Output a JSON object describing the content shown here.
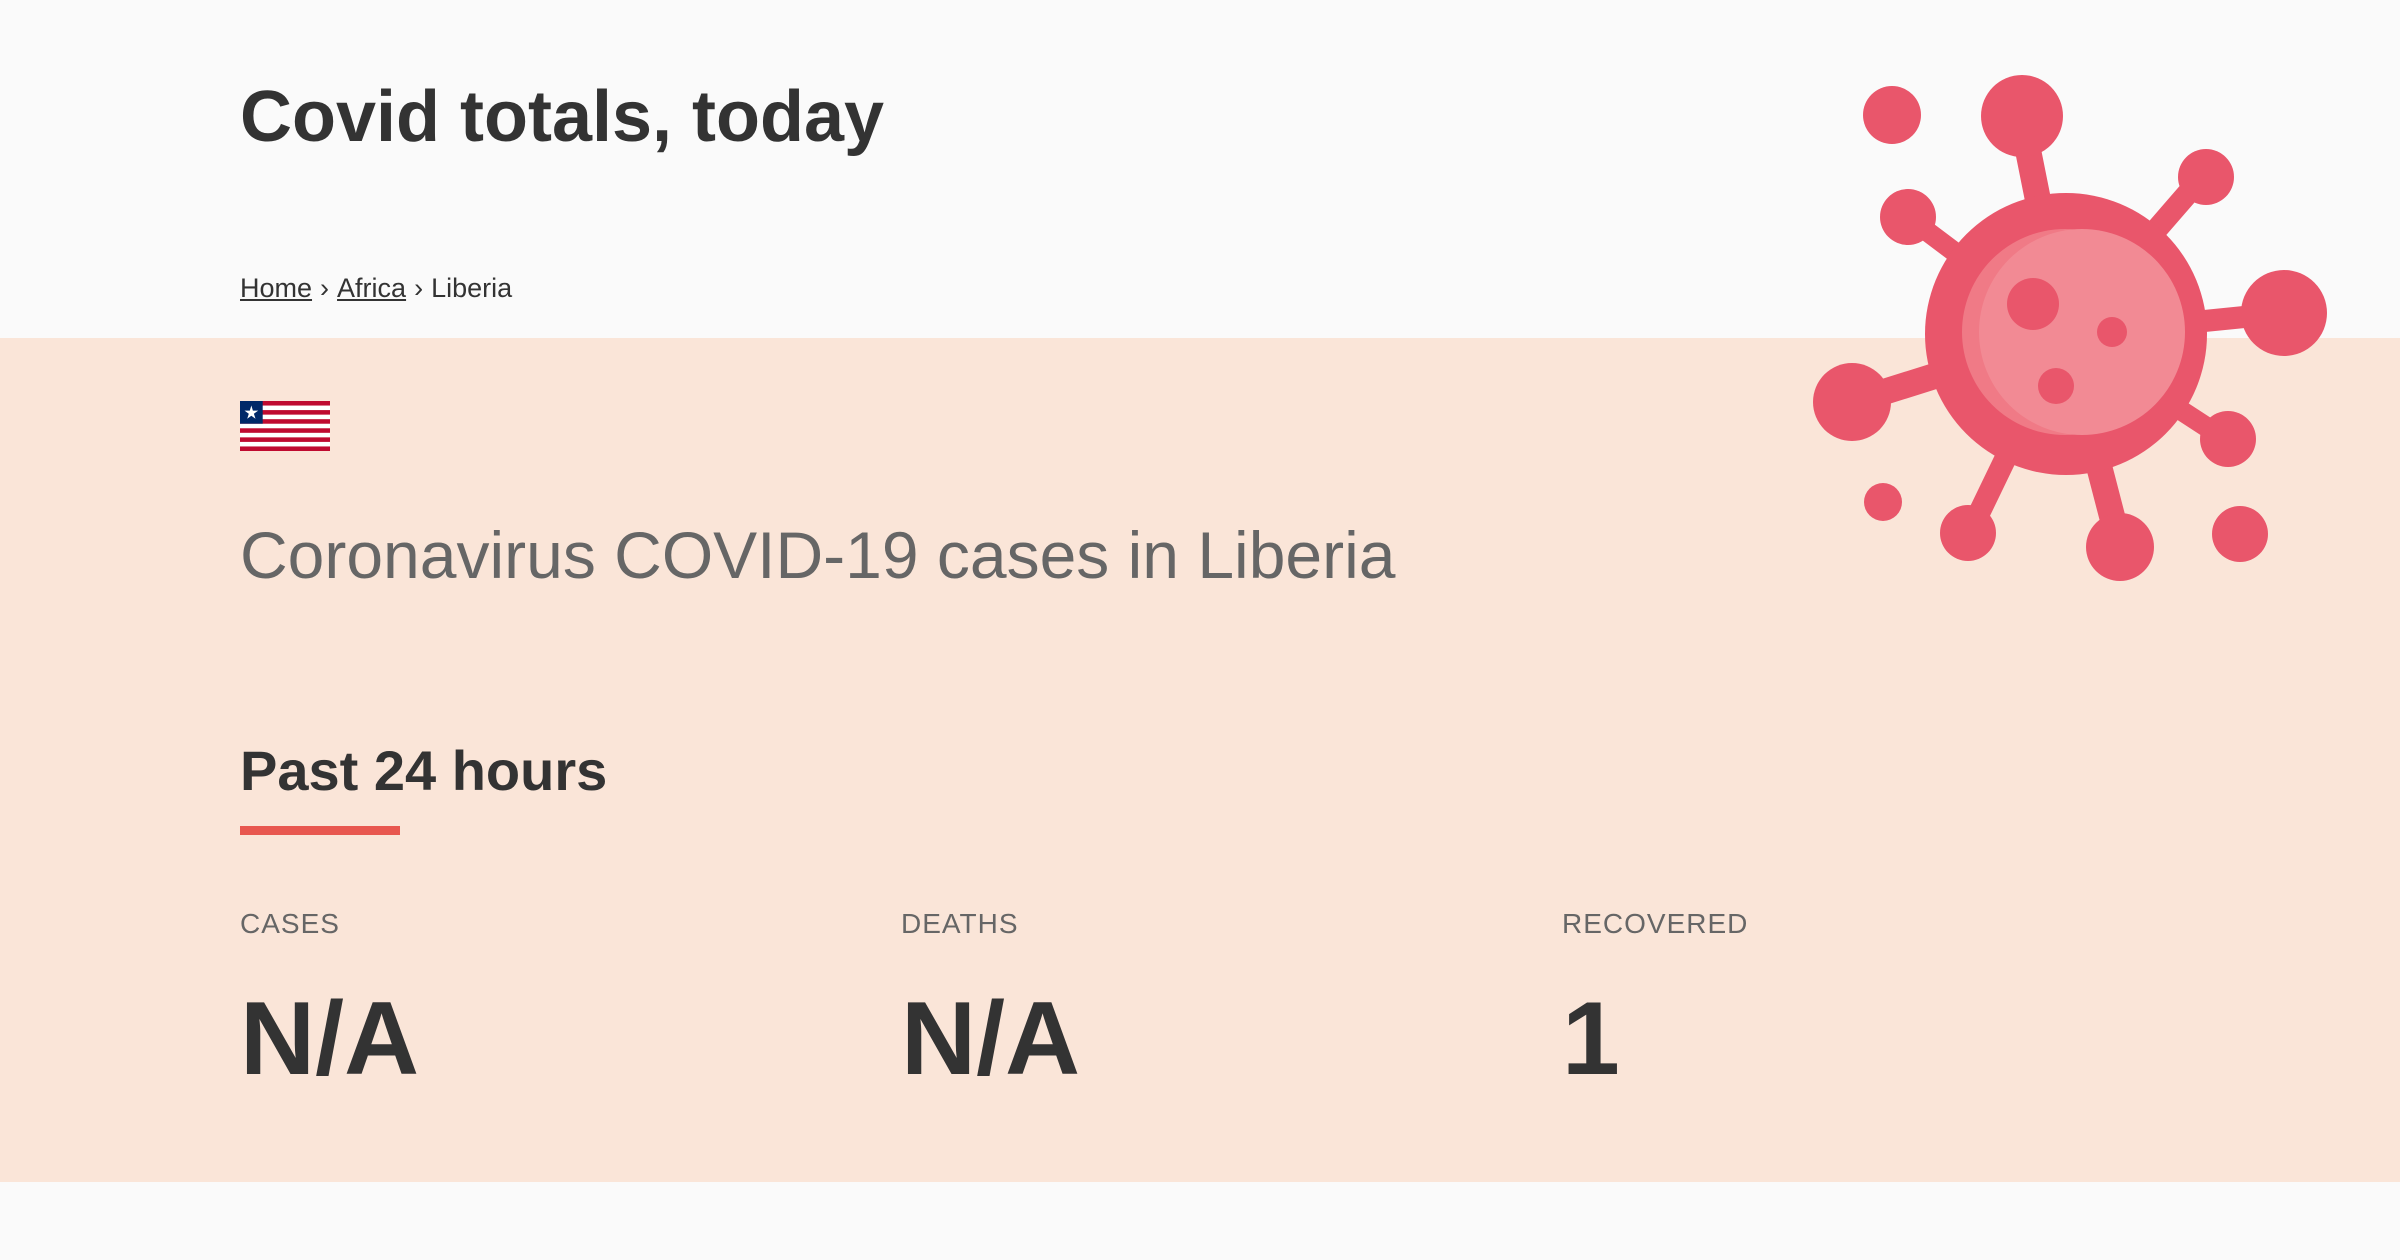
{
  "site": {
    "title": "Covid totals, today"
  },
  "breadcrumb": {
    "items": [
      {
        "label": "Home",
        "link": true
      },
      {
        "label": "Africa",
        "link": true
      },
      {
        "label": "Liberia",
        "link": false
      }
    ],
    "separator": "›"
  },
  "country": {
    "heading": "Coronavirus COVID-19 cases in Liberia"
  },
  "section": {
    "heading": "Past 24 hours"
  },
  "stats": [
    {
      "label": "CASES",
      "value": "N/A"
    },
    {
      "label": "DEATHS",
      "value": "N/A"
    },
    {
      "label": "RECOVERED",
      "value": "1"
    }
  ],
  "colors": {
    "background": "#fafafa",
    "panel": "#fae5d8",
    "accent": "#e8574f",
    "virus": "#e9566b",
    "virus_light": "#f28a94",
    "text_dark": "#333333",
    "text_muted": "#666666"
  },
  "icons": {
    "flag": "liberia-flag-icon",
    "illustration": "coronavirus-icon"
  }
}
